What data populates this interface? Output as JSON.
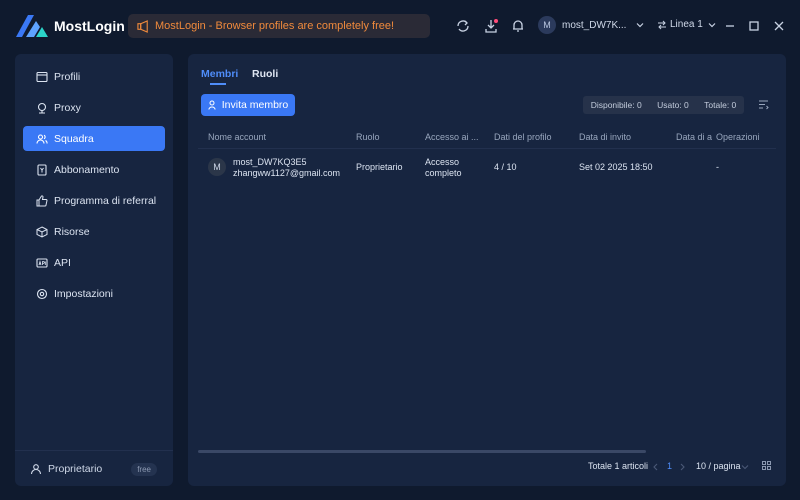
{
  "app": {
    "name": "MostLogin"
  },
  "announcement": {
    "text": "MostLogin - Browser profiles are completely free!"
  },
  "user": {
    "avatar_letter": "M",
    "name": "most_DW7K..."
  },
  "line": {
    "label": "Linea 1"
  },
  "sidebar": {
    "items": [
      {
        "label": "Profili",
        "icon": "browser-window-icon"
      },
      {
        "label": "Proxy",
        "icon": "proxy-icon"
      },
      {
        "label": "Squadra",
        "icon": "team-icon",
        "active": true
      },
      {
        "label": "Abbonamento",
        "icon": "subscription-icon"
      },
      {
        "label": "Programma di referral",
        "icon": "thumbs-up-icon"
      },
      {
        "label": "Risorse",
        "icon": "cube-icon"
      },
      {
        "label": "API",
        "icon": "api-icon"
      },
      {
        "label": "Impostazioni",
        "icon": "settings-icon"
      }
    ],
    "footer": {
      "label": "Proprietario",
      "badge": "free"
    }
  },
  "tabs": [
    {
      "label": "Membri",
      "active": true
    },
    {
      "label": "Ruoli"
    }
  ],
  "invite_button": {
    "label": "Invita membro"
  },
  "stats": {
    "available": "Disponibile: 0",
    "used": "Usato: 0",
    "total": "Totale: 0"
  },
  "table": {
    "columns": [
      "Nome account",
      "Ruolo",
      "Accesso ai ...",
      "Dati del profilo",
      "Data di invito",
      "Data di a",
      "Operazioni"
    ],
    "rows": [
      {
        "avatar": "M",
        "account_name": "most_DW7KQ3E5",
        "email": "zhangww1127@gmail.com",
        "role": "Proprietario",
        "access_line1": "Accesso",
        "access_line2": "completo",
        "profile_data": "4 / 10",
        "invite_date": "Set 02 2025 18:50",
        "access_date": "",
        "operations": "-"
      }
    ]
  },
  "pagination": {
    "total": "Totale 1 articoli",
    "current_page": "1",
    "page_size": "10 / pagina"
  },
  "colors": {
    "accent": "#3a78f5",
    "announcement": "#f08a3c",
    "background": "#0f1a2e",
    "panel": "#172540"
  }
}
